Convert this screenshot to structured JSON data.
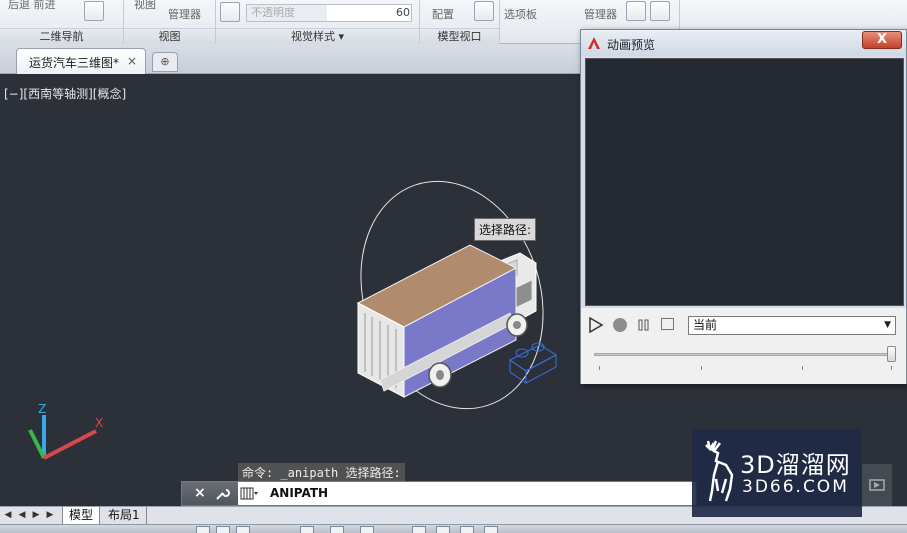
{
  "ribbon": {
    "panels": [
      {
        "name": "二维导航",
        "frag": "后退  前进"
      },
      {
        "name": "视图",
        "frag": "视图"
      },
      {
        "name": "视觉样式",
        "frag": "不透明度",
        "value": "60"
      },
      {
        "name": "模型视口",
        "frag": "配置"
      }
    ],
    "frag_view_manager": "管理器",
    "frag_options": "选项板",
    "frag_manager2": "管理器"
  },
  "document_tab": {
    "label": "运货汽车三维图*",
    "close": "×"
  },
  "viewport": {
    "label": "[−][西南等轴测][概念]",
    "tooltip": "选择路径:"
  },
  "dialog": {
    "title": "动画预览",
    "close": "X",
    "view_select": "当前"
  },
  "command": {
    "history": "命令: _anipath 选择路径:",
    "input": "ANIPATH",
    "close": "×"
  },
  "layout_tabs": {
    "model": "模型",
    "layout1": "布局1"
  },
  "watermark": {
    "big": "3D溜溜网",
    "small": "3D66.COM"
  },
  "colors": {
    "viewport_bg": "#2c3038",
    "cargo_side": "#7a78c8",
    "cargo_top": "#b08b6e"
  }
}
